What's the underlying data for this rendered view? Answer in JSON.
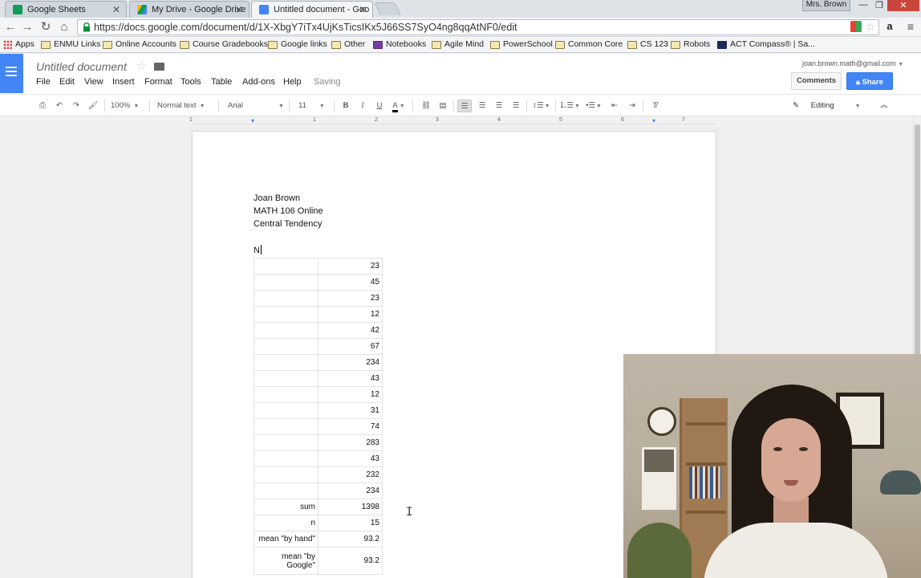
{
  "browser": {
    "tabs": [
      {
        "label": "Google Sheets",
        "icon": "sheets-icon",
        "color": "#0f9d58"
      },
      {
        "label": "My Drive - Google Drive",
        "icon": "drive-icon",
        "color": "#4285f4"
      },
      {
        "label": "Untitled document - Goo",
        "icon": "docs-icon",
        "color": "#4285f4"
      }
    ],
    "profile": "Mrs. Brown",
    "url": "https://docs.google.com/document/d/1X-XbgY7iTx4UjKsTicsIKx5J66SS7SyO4ng8qqAtNF0/edit"
  },
  "bookmarks": [
    {
      "label": "Apps",
      "type": "apps"
    },
    {
      "label": "ENMU Links",
      "type": "folder"
    },
    {
      "label": "Online Accounts",
      "type": "folder"
    },
    {
      "label": "Course Gradebooks",
      "type": "folder"
    },
    {
      "label": "Google links",
      "type": "folder"
    },
    {
      "label": "Other",
      "type": "folder"
    },
    {
      "label": "Notebooks",
      "type": "onenote"
    },
    {
      "label": "Agile Mind",
      "type": "folder"
    },
    {
      "label": "PowerSchool",
      "type": "folder"
    },
    {
      "label": "Common Core",
      "type": "folder"
    },
    {
      "label": "CS 123",
      "type": "folder"
    },
    {
      "label": "Robots",
      "type": "folder"
    },
    {
      "label": "ACT Compass® | Sa...",
      "type": "act"
    }
  ],
  "docs": {
    "title": "Untitled document",
    "menu": [
      "File",
      "Edit",
      "View",
      "Insert",
      "Format",
      "Tools",
      "Table",
      "Add-ons",
      "Help"
    ],
    "status": "Saving",
    "user_email": "joan.brown.math@gmail.com",
    "comments_label": "Comments",
    "share_label": "Share",
    "accent": "#4285f4"
  },
  "format_bar": {
    "zoom": "100%",
    "style": "Normal text",
    "font": "Arial",
    "size": "11",
    "mode": "Editing"
  },
  "ruler": [
    "1",
    "1",
    "2",
    "3",
    "4",
    "5",
    "6",
    "7"
  ],
  "document": {
    "lines": [
      "Joan Brown",
      "MATH 106 Online",
      "Central Tendency"
    ],
    "typing": "N",
    "table": [
      [
        "",
        "23"
      ],
      [
        "",
        "45"
      ],
      [
        "",
        "23"
      ],
      [
        "",
        "12"
      ],
      [
        "",
        "42"
      ],
      [
        "",
        "67"
      ],
      [
        "",
        "234"
      ],
      [
        "",
        "43"
      ],
      [
        "",
        "12"
      ],
      [
        "",
        "31"
      ],
      [
        "",
        "74"
      ],
      [
        "",
        "283"
      ],
      [
        "",
        "43"
      ],
      [
        "",
        "232"
      ],
      [
        "",
        "234"
      ],
      [
        "sum",
        "1398"
      ],
      [
        "n",
        "15"
      ],
      [
        "mean \"by hand\"",
        "93.2"
      ],
      [
        "mean \"by Google\"",
        "93.2"
      ]
    ]
  }
}
